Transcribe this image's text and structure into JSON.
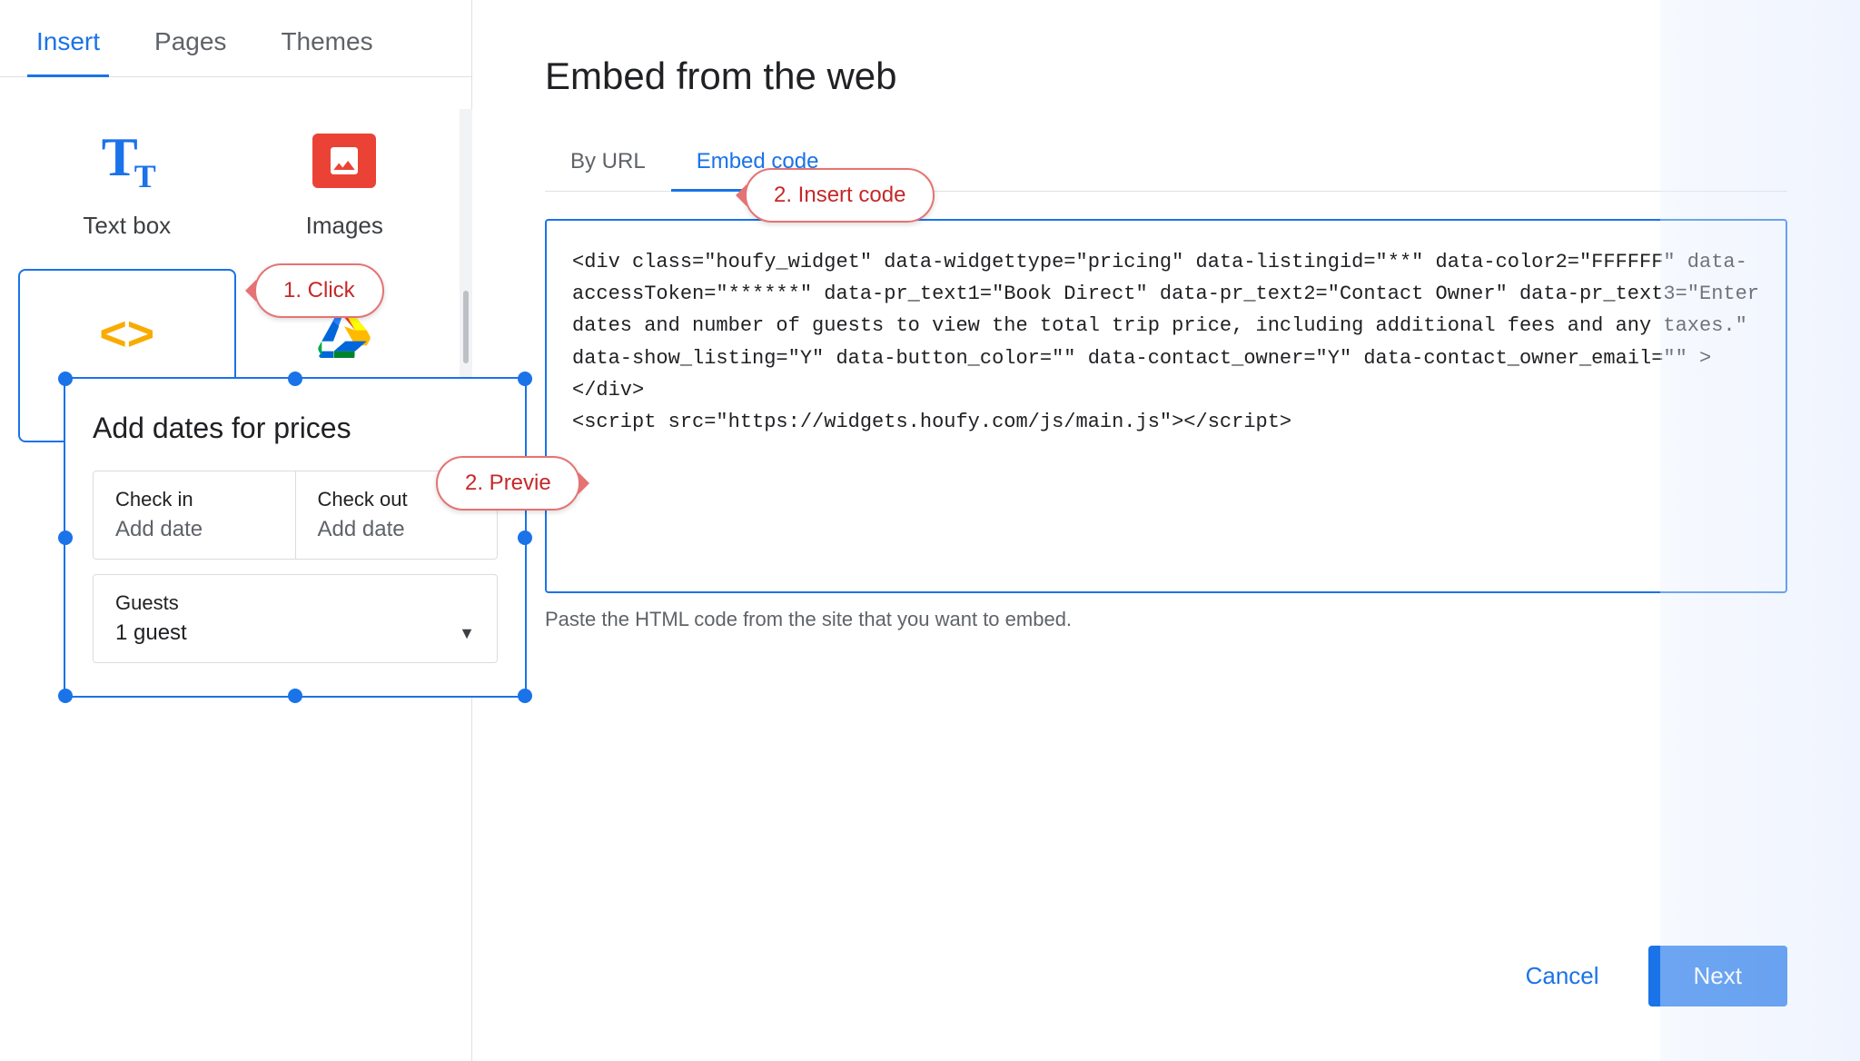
{
  "tabs": {
    "insert": "Insert",
    "pages": "Pages",
    "themes": "Themes"
  },
  "insert_items": [
    {
      "id": "text-box",
      "label": "Text box",
      "icon": "textbox-icon"
    },
    {
      "id": "images",
      "label": "Images",
      "icon": "images-icon"
    },
    {
      "id": "embed",
      "label": "Embed",
      "icon": "embed-icon"
    },
    {
      "id": "drive",
      "label": "Drive",
      "icon": "drive-icon"
    }
  ],
  "dialog": {
    "title": "Embed from the web",
    "tab_url": "By URL",
    "tab_embed": "Embed code",
    "code_value": "<div class=\"houfy_widget\" data-widgettype=\"pricing\" data-listingid=\"**\" data-color2=\"FFFFFF\" data-accessToken=\"******\" data-pr_text1=\"Book Direct\" data-pr_text2=\"Contact Owner\" data-pr_text3=\"Enter dates and number of guests to view the total trip price, including additional fees and any taxes.\" data-show_listing=\"Y\" data-button_color=\"\" data-contact_owner=\"Y\" data-contact_owner_email=\"\" ></div>\n<script src=\"https://widgets.houfy.com/js/main.js\"></script>",
    "hint": "Paste the HTML code from the site that you want to embed.",
    "cancel_label": "Cancel",
    "next_label": "Next"
  },
  "widget": {
    "title": "Add dates for prices",
    "checkin_label": "Check in",
    "checkin_value": "Add date",
    "checkout_label": "Check out",
    "checkout_value": "Add date",
    "guests_label": "Guests",
    "guests_value": "1 guest"
  },
  "bubbles": {
    "click": "1. Click",
    "insert_code": "2. Insert code",
    "preview": "2. Previe"
  },
  "colors": {
    "blue": "#1a73e8",
    "red_border": "#e57373",
    "text_dark": "#202124",
    "text_muted": "#5f6368"
  }
}
